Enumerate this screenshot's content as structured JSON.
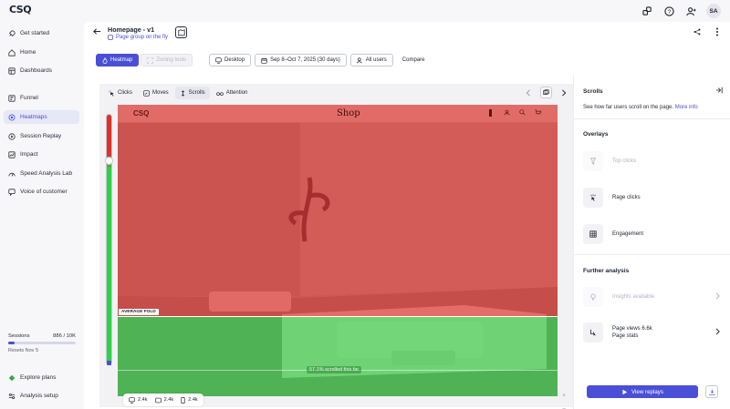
{
  "app": {
    "logo": "CSQ",
    "avatar_initials": "SA"
  },
  "sidebar": {
    "items": [
      {
        "label": "Get started",
        "icon": "rocket-icon"
      },
      {
        "label": "Home",
        "icon": "home-icon"
      },
      {
        "label": "Dashboards",
        "icon": "dashboard-icon"
      },
      {
        "label": "Funnel",
        "icon": "funnel-icon"
      },
      {
        "label": "Heatmaps",
        "icon": "heatmap-icon",
        "active": true
      },
      {
        "label": "Session Replay",
        "icon": "replay-icon"
      },
      {
        "label": "Impact",
        "icon": "impact-icon"
      },
      {
        "label": "Speed Analysis Lab",
        "icon": "speed-icon"
      },
      {
        "label": "Voice of customer",
        "icon": "chat-icon"
      }
    ],
    "sessions": {
      "label": "Sessions",
      "count": "886 / 10K",
      "progress_pct": 8.86,
      "resets": "Resets Nov 5"
    },
    "explore_plans": "Explore plans",
    "analysis_setup": "Analysis setup"
  },
  "header": {
    "title": "Homepage - v1",
    "subtitle": "Page group on the fly"
  },
  "toolbar": {
    "heatmap": "Heatmap",
    "zoning": "Zoning tools",
    "device": "Desktop",
    "date_range": "Sep 8–Oct 7, 2025 (30 days)",
    "users": "All users",
    "compare": "Compare"
  },
  "viewer": {
    "tabs": [
      "Clicks",
      "Moves",
      "Scrolls",
      "Attention"
    ],
    "active_tab": "Scrolls",
    "site_logo": "CSQ",
    "site_title": "Shop",
    "fold_label": "AVERAGE FOLD",
    "scroll_label": "57.1% scrolled this far",
    "devices": [
      {
        "icon": "desktop-icon",
        "value": "2.4k"
      },
      {
        "icon": "tablet-icon",
        "value": "2.4k"
      },
      {
        "icon": "mobile-icon",
        "value": "2.4k"
      }
    ],
    "zoom_in": "+",
    "zoom_out": "−"
  },
  "right_panel": {
    "title": "Scrolls",
    "description": "See how far users scroll on the page.",
    "more_info": "More info",
    "overlays_title": "Overlays",
    "overlays": [
      "Top clicks",
      "Rage clicks",
      "Engagement"
    ],
    "further_title": "Further analysis",
    "insights": "Insights available",
    "page_views": "Page views 6.6k",
    "page_stats": "Page stats",
    "view_replays": "View replays"
  },
  "colors": {
    "accent": "#4a4fd6",
    "heat_red": "#e0302a",
    "heat_green": "#2fd14a"
  }
}
